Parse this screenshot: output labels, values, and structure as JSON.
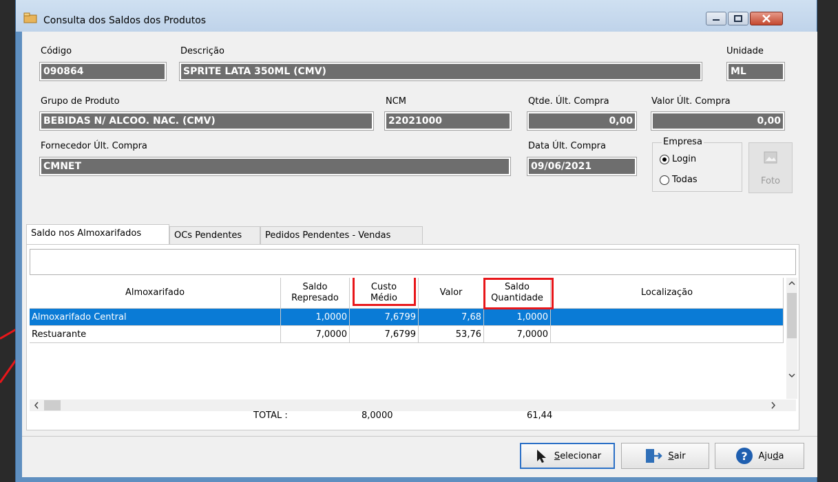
{
  "window": {
    "title": "Consulta dos Saldos dos Produtos"
  },
  "fields": {
    "codigo": {
      "label": "Código",
      "value": "090864"
    },
    "descricao": {
      "label": "Descrição",
      "value": "SPRITE LATA 350ML (CMV)"
    },
    "unidade": {
      "label": "Unidade",
      "value": "ML"
    },
    "grupo": {
      "label": "Grupo de Produto",
      "value": "BEBIDAS N/ ALCOO. NAC. (CMV)"
    },
    "ncm": {
      "label": "NCM",
      "value": "22021000"
    },
    "qtde_ult_compra": {
      "label": "Qtde. Últ. Compra",
      "value": "0,00"
    },
    "valor_ult_compra": {
      "label": "Valor Últ. Compra",
      "value": "0,00"
    },
    "fornecedor": {
      "label": "Fornecedor Últ. Compra",
      "value": "CMNET"
    },
    "data_ult_compra": {
      "label": "Data Últ. Compra",
      "value": "09/06/2021"
    }
  },
  "empresa": {
    "legend": "Empresa",
    "options": [
      "Login",
      "Todas"
    ],
    "selected": "Login"
  },
  "foto_label": "Foto",
  "tabs": [
    "Saldo nos Almoxarifados",
    "OCs Pendentes",
    "Pedidos Pendentes - Vendas"
  ],
  "grid": {
    "headers": {
      "almoxarifado": "Almoxarifado",
      "saldo_rep_1": "Saldo",
      "saldo_rep_2": "Represado",
      "custo_1": "Custo",
      "custo_2": "Médio",
      "valor": "Valor",
      "saldo_qtd_1": "Saldo",
      "saldo_qtd_2": "Quantidade",
      "localizacao": "Localização"
    },
    "rows": [
      {
        "almoxarifado": "Almoxarifado Central",
        "saldo_represado": "1,0000",
        "custo_medio": "7,6799",
        "valor": "7,68",
        "saldo_quantidade": "1,0000",
        "localizacao": ""
      },
      {
        "almoxarifado": "Restuarante",
        "saldo_represado": "7,0000",
        "custo_medio": "7,6799",
        "valor": "53,76",
        "saldo_quantidade": "7,0000",
        "localizacao": ""
      }
    ]
  },
  "totals": {
    "label": "TOTAL :",
    "saldo": "8,0000",
    "valor": "61,44"
  },
  "buttons": {
    "selecionar": {
      "first": "S",
      "rest": "elecionar"
    },
    "sair": {
      "first": "S",
      "rest": "air"
    },
    "ajuda": {
      "pre": "Aju",
      "u": "d",
      "post": "a"
    }
  },
  "colors": {
    "selection": "#0a7bd6",
    "highlight": "#e8161a",
    "field_bg": "#6e6e6e"
  }
}
